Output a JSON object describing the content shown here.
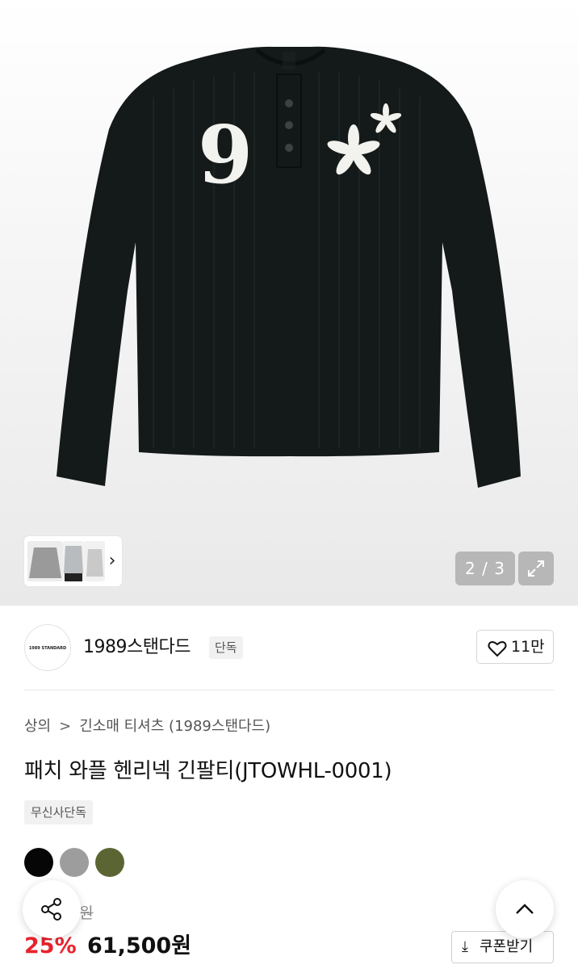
{
  "gallery": {
    "counter": "2 / 3",
    "thumbnail_next": "›",
    "image_text": {
      "number_patch": "9"
    }
  },
  "brand": {
    "logo_text": "1989 STANDARD",
    "name": "1989스탠다드",
    "badge": "단독",
    "like_count": "11만"
  },
  "breadcrumb": {
    "items": [
      "상의",
      "긴소매 티셔츠",
      "(1989스탠다드)"
    ],
    "separator": ">"
  },
  "product": {
    "title": "패치 와플 헨리넥 긴팔티(JTOWHL-0001)",
    "tag": "무신사단독",
    "colors": [
      "#060606",
      "#9d9d9d",
      "#5b6533"
    ]
  },
  "price": {
    "original_partial": "0원",
    "discount_rate": "25%",
    "sale_price": "61,500원",
    "coupon_icon": "⤓",
    "coupon_label": "쿠폰받기"
  },
  "icons": {
    "expand": "expand-icon",
    "heart": "heart-icon",
    "share": "share-icon",
    "scroll_top": "chevron-up-icon"
  }
}
